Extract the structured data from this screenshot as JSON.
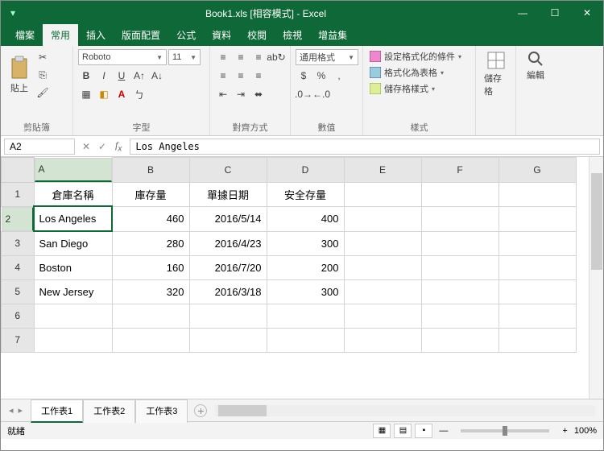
{
  "title": "Book1.xls [相容模式] - Excel",
  "menu_tabs": [
    "檔案",
    "常用",
    "插入",
    "版面配置",
    "公式",
    "資料",
    "校閱",
    "檢視",
    "增益集"
  ],
  "active_tab": 1,
  "ribbon": {
    "clipboard": {
      "paste": "貼上",
      "label": "剪貼簿"
    },
    "font": {
      "name": "Roboto",
      "size": "11",
      "label": "字型"
    },
    "align": {
      "label": "對齊方式"
    },
    "number": {
      "format": "通用格式",
      "label": "數值"
    },
    "styles": {
      "cond": "設定格式化的條件",
      "table": "格式化為表格",
      "cell": "儲存格樣式",
      "label": "樣式"
    },
    "cells": {
      "label": "儲存格"
    },
    "edit": {
      "label": "編輯"
    }
  },
  "namebox": {
    "ref": "A2",
    "formula": "Los Angeles"
  },
  "columns": [
    "A",
    "B",
    "C",
    "D",
    "E",
    "F",
    "G"
  ],
  "active_cell": {
    "row": 2,
    "col": 0
  },
  "headers": [
    "倉庫名稱",
    "庫存量",
    "單據日期",
    "安全存量"
  ],
  "data_rows": [
    {
      "name": "Los Angeles",
      "qty": "460",
      "date": "2016/5/14",
      "safe": "400"
    },
    {
      "name": "San Diego",
      "qty": "280",
      "date": "2016/4/23",
      "safe": "300"
    },
    {
      "name": "Boston",
      "qty": "160",
      "date": "2016/7/20",
      "safe": "200"
    },
    {
      "name": "New Jersey",
      "qty": "320",
      "date": "2016/3/18",
      "safe": "300"
    }
  ],
  "sheets": [
    "工作表1",
    "工作表2",
    "工作表3"
  ],
  "active_sheet": 0,
  "status": {
    "ready": "就緒",
    "zoom": "100%"
  }
}
